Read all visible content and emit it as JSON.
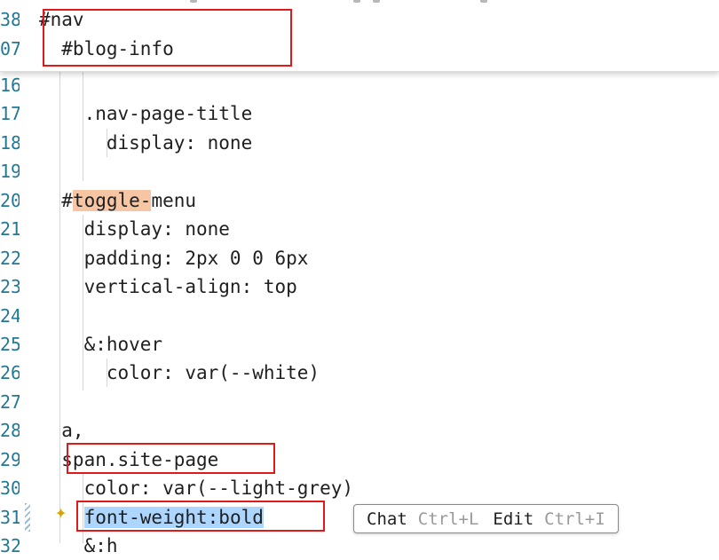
{
  "sticky_scroll": [
    {
      "line": "38",
      "text": "#nav"
    },
    {
      "line": "07",
      "text": "  #blog-info"
    }
  ],
  "lines": [
    {
      "num": "16",
      "text": ""
    },
    {
      "num": "17",
      "text": "    .nav-page-title"
    },
    {
      "num": "18",
      "text": "      display: none"
    },
    {
      "num": "19",
      "text": ""
    },
    {
      "num": "20",
      "pre": "  #",
      "highlight": "toggle-",
      "post": "menu"
    },
    {
      "num": "21",
      "text": "    display: none"
    },
    {
      "num": "22",
      "text": "    padding: 2px 0 0 6px"
    },
    {
      "num": "23",
      "text": "    vertical-align: top"
    },
    {
      "num": "24",
      "text": ""
    },
    {
      "num": "25",
      "text": "    &:hover"
    },
    {
      "num": "26",
      "text": "      color: var(--white)"
    },
    {
      "num": "27",
      "text": ""
    },
    {
      "num": "28",
      "text": "  a,"
    },
    {
      "num": "29",
      "text": "  span.site-page"
    },
    {
      "num": "30",
      "text": "    color: var(--light-grey)"
    },
    {
      "num": "31",
      "pre": "    ",
      "selected": "font-weight:bold",
      "post": ""
    },
    {
      "num": "32",
      "text": "    &:h"
    }
  ],
  "inline_hint": {
    "chat_label": "Chat",
    "chat_shortcut": "Ctrl+L",
    "edit_label": "Edit",
    "edit_shortcut": "Ctrl+I"
  },
  "colors": {
    "line_number": "#237893",
    "annotation_box": "#e01a1a",
    "word_highlight": "#f6c6a4",
    "selection": "#add6ff"
  }
}
